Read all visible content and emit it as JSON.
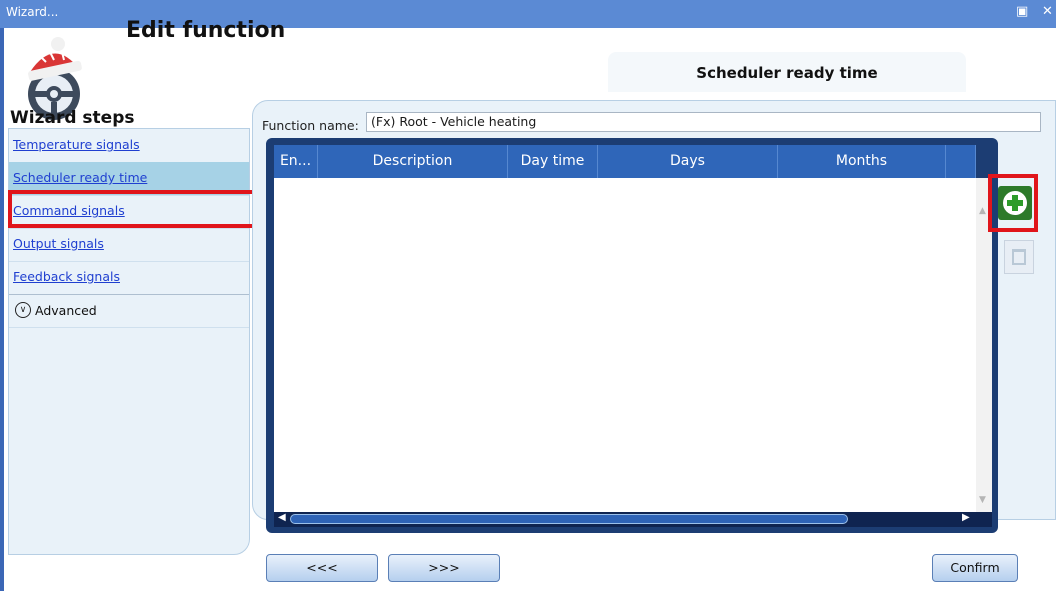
{
  "window": {
    "title": "Wizard...",
    "restore_icon": "restore-icon",
    "close_icon": "close-icon"
  },
  "header": {
    "title": "Edit function",
    "logo_icon": "vehicle-heating-steering-wheel-with-hat-icon"
  },
  "tab": {
    "title": "Scheduler ready time"
  },
  "sidebar": {
    "heading": "Wizard steps",
    "items": [
      {
        "label": "Temperature signals",
        "selected": false
      },
      {
        "label": "Scheduler ready time",
        "selected": true
      },
      {
        "label": "Command signals",
        "selected": false
      },
      {
        "label": "Output signals",
        "selected": false
      },
      {
        "label": "Feedback signals",
        "selected": false
      }
    ],
    "advanced": {
      "label": "Advanced",
      "icon": "chevron-down-circle-icon"
    }
  },
  "form": {
    "function_name_label": "Function name:",
    "function_name_value": "(Fx) Root - Vehicle heating"
  },
  "table": {
    "columns": [
      "En...",
      "Description",
      "Day time",
      "Days",
      "Months"
    ],
    "rows": []
  },
  "actions": {
    "add_icon": "add-icon",
    "delete_icon": "recycle-bin-icon"
  },
  "footer": {
    "back_label": "<<<",
    "next_label": ">>>",
    "confirm_label": "Confirm"
  },
  "colors": {
    "titlebar": "#5b8ad4",
    "grid_header": "#2f66b9",
    "highlight": "#e0151b",
    "selected_step": "#a6d2e6",
    "link": "#1f3fd0"
  }
}
